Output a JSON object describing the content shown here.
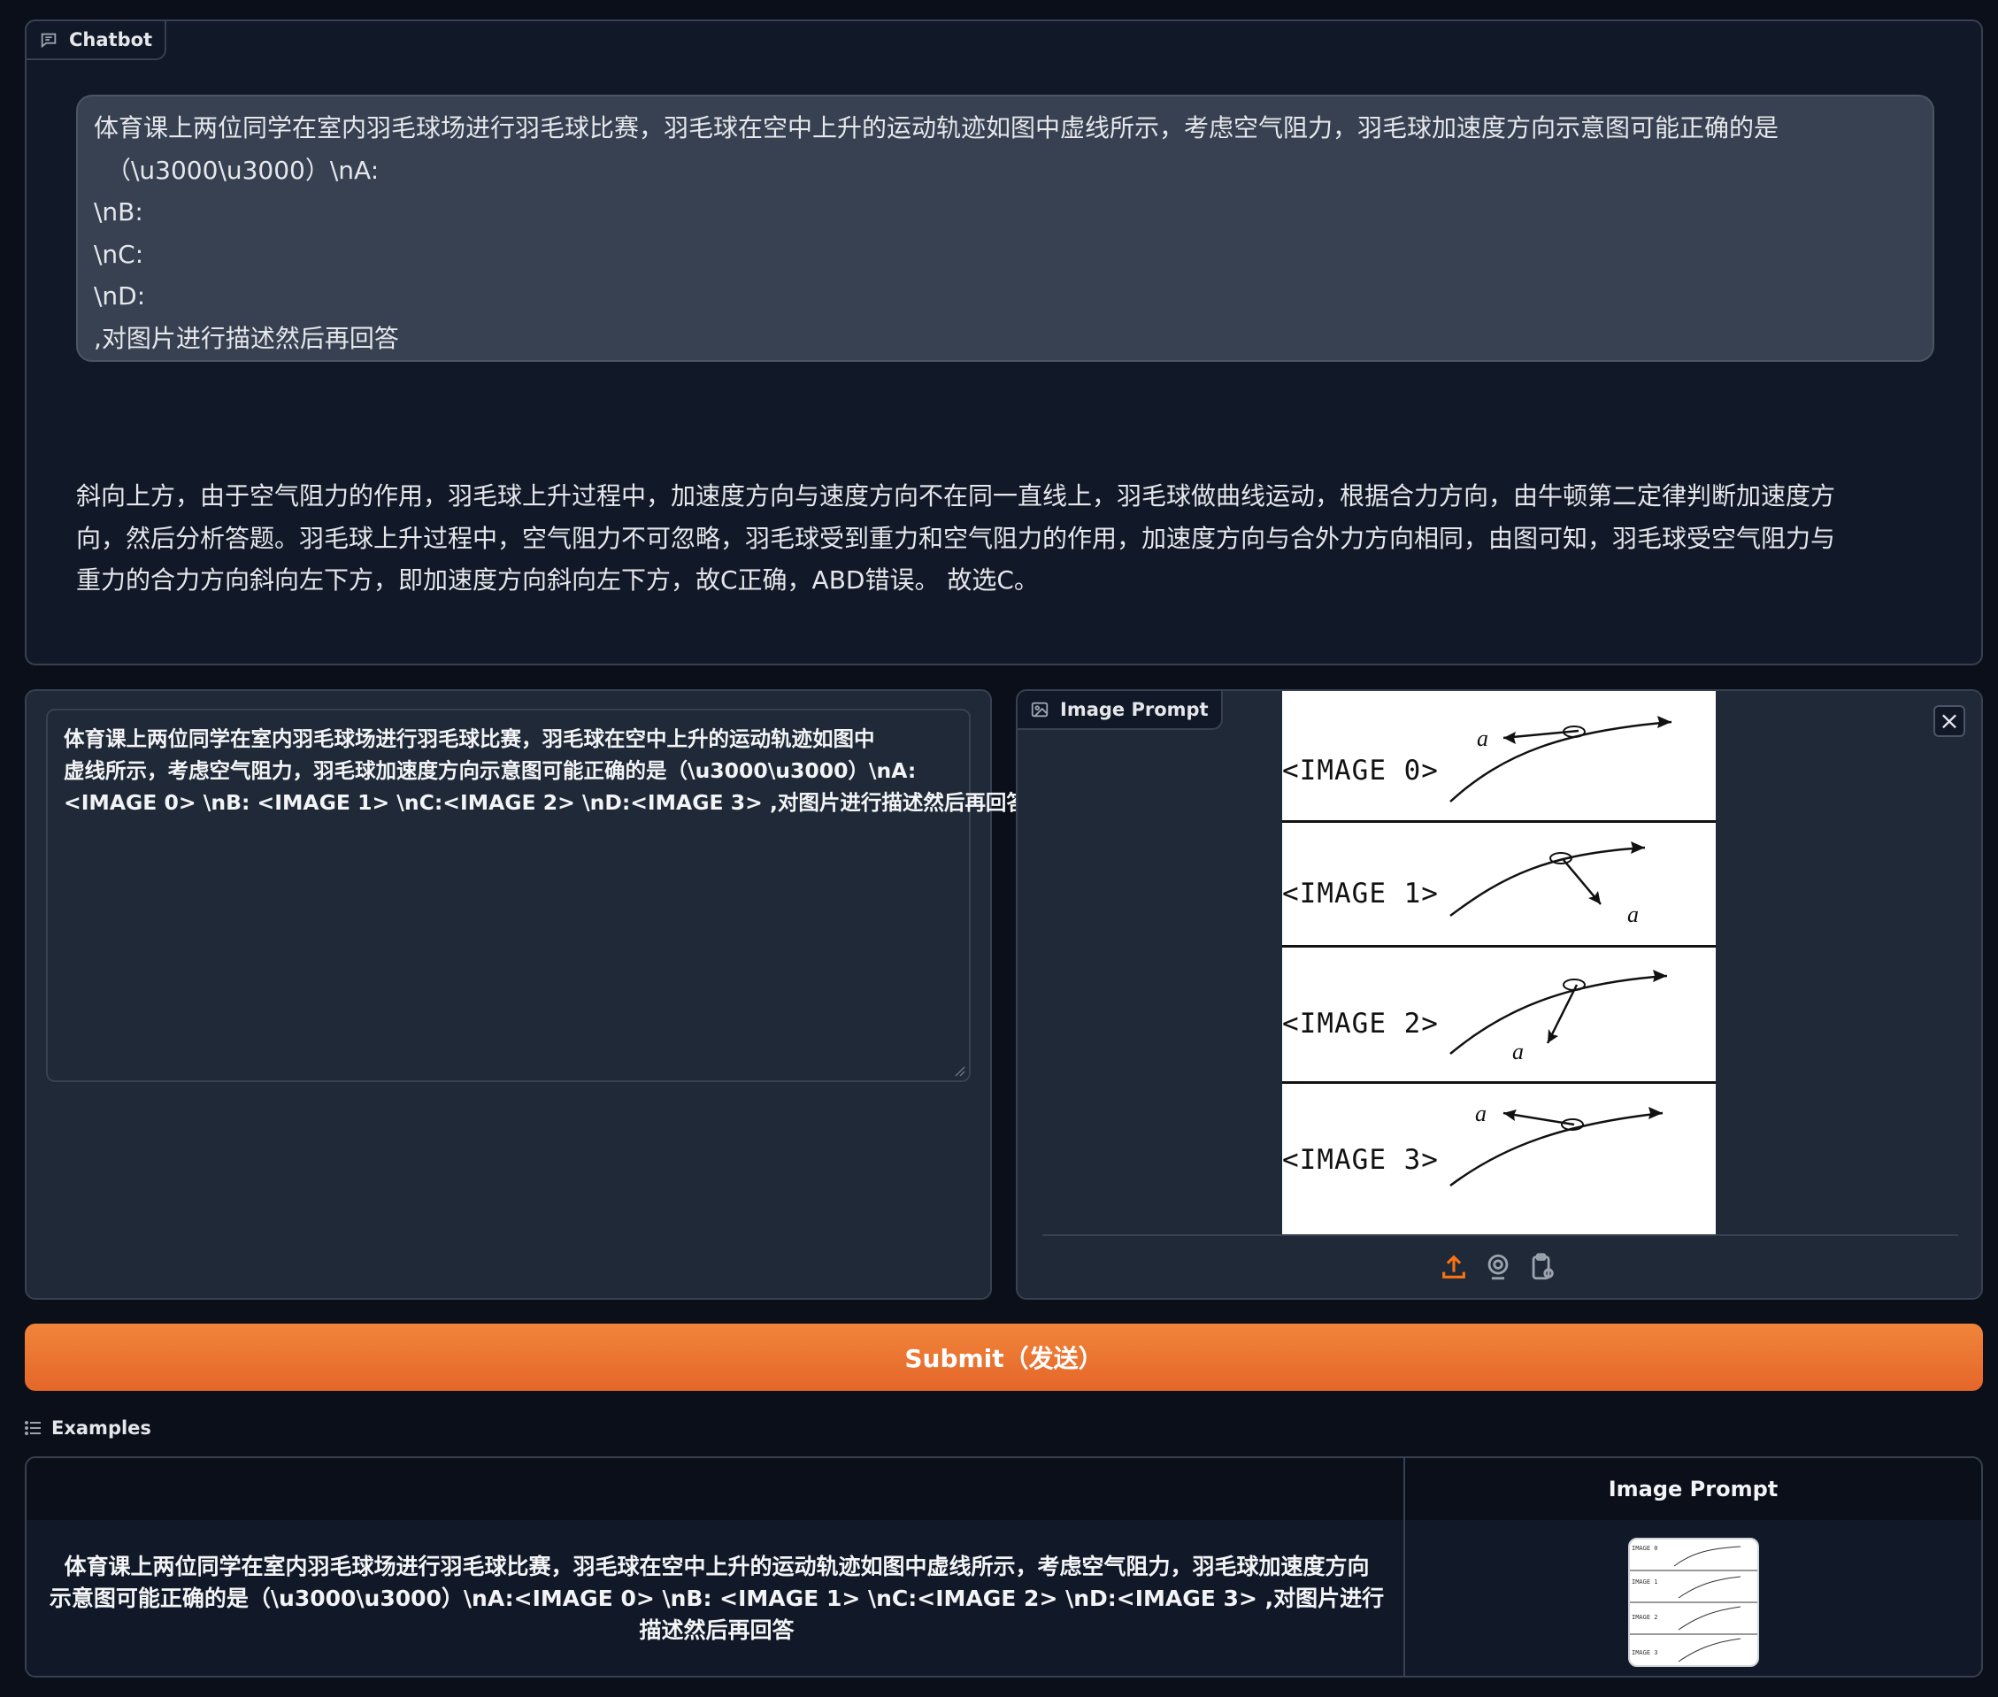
{
  "chatbot": {
    "label": "Chatbot",
    "user_lines": [
      "体育课上两位同学在室内羽毛球场进行羽毛球比赛，羽毛球在空中上升的运动轨迹如图中虚线所示，考虑空气阻力，羽毛球加速度方向示意图可能正确的是",
      "（\\u3000\\u3000）\\nA:",
      "\\nB:",
      "\\nC:",
      "\\nD:",
      ",对图片进行描述然后再回答"
    ],
    "bot_lines": [
      "斜向上方，由于空气阻力的作用，羽毛球上升过程中，加速度方向与速度方向不在同一直线上，羽毛球做曲线运动，根据合力方向，由牛顿第二定律判断加速度方",
      "向，然后分析答题。羽毛球上升过程中，空气阻力不可忽略，羽毛球受到重力和空气阻力的作用，加速度方向与合外力方向相同，由图可知，羽毛球受空气阻力与",
      "重力的合力方向斜向左下方，即加速度方向斜向左下方，故C正确，ABD错误。 故选C。"
    ]
  },
  "textbox": {
    "lines": [
      "体育课上两位同学在室内羽毛球场进行羽毛球比赛，羽毛球在空中上升的运动轨迹如图中",
      "虚线所示，考虑空气阻力，羽毛球加速度方向示意图可能正确的是（\\u3000\\u3000）\\nA:",
      "<IMAGE 0> \\nB: <IMAGE 1> \\nC:<IMAGE 2> \\nD:<IMAGE 3> ,对图片进行描述然后再回答"
    ]
  },
  "image_prompt": {
    "label": "Image Prompt",
    "close_symbol": "×",
    "strips": [
      {
        "label": "<IMAGE 0>",
        "accel_label": "a"
      },
      {
        "label": "<IMAGE 1>",
        "accel_label": "a"
      },
      {
        "label": "<IMAGE 2>",
        "accel_label": "a"
      },
      {
        "label": "<IMAGE 3>",
        "accel_label": "a"
      }
    ],
    "source_icons": [
      "upload-icon",
      "webcam-icon",
      "clipboard-icon"
    ]
  },
  "submit": {
    "label": "Submit（发送）"
  },
  "examples": {
    "label": "Examples",
    "header_col2": "Image Prompt",
    "row_text_lines": [
      "体育课上两位同学在室内羽毛球场进行羽毛球比赛，羽毛球在空中上升的运动轨迹如图中虚线所示，考虑空气阻力，羽毛球加速度方向",
      "示意图可能正确的是（\\u3000\\u3000）\\nA:<IMAGE 0> \\nB: <IMAGE 1> \\nC:<IMAGE 2> \\nD:<IMAGE 3> ,对图片进行描述然后再回答"
    ]
  },
  "colors": {
    "background": "#0b0f19",
    "panel": "#1f2937",
    "user_bubble": "#374151",
    "accent": "#e5662a"
  }
}
